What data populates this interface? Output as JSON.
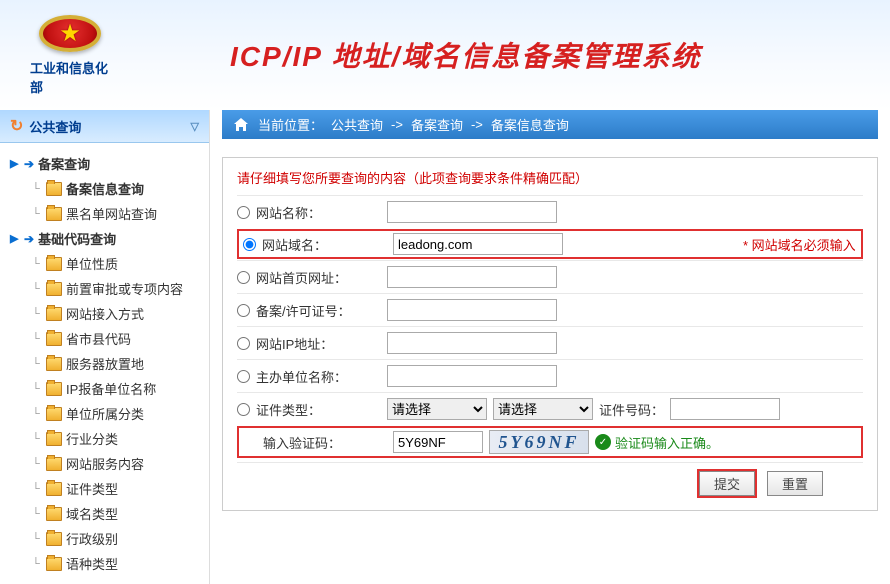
{
  "header": {
    "ministry": "工业和信息化部",
    "title": "ICP/IP 地址/域名信息备案管理系统"
  },
  "sidebar": {
    "heading": "公共查询",
    "groups": [
      {
        "label": "备案查询",
        "children": [
          {
            "label": "备案信息查询",
            "selected": true
          },
          {
            "label": "黑名单网站查询"
          }
        ]
      },
      {
        "label": "基础代码查询",
        "children": [
          {
            "label": "单位性质"
          },
          {
            "label": "前置审批或专项内容"
          },
          {
            "label": "网站接入方式"
          },
          {
            "label": "省市县代码"
          },
          {
            "label": "服务器放置地"
          },
          {
            "label": "IP报备单位名称"
          },
          {
            "label": "单位所属分类"
          },
          {
            "label": "行业分类"
          },
          {
            "label": "网站服务内容"
          },
          {
            "label": "证件类型"
          },
          {
            "label": "域名类型"
          },
          {
            "label": "行政级别"
          },
          {
            "label": "语种类型"
          }
        ]
      }
    ]
  },
  "breadcrumb": {
    "prefix": "当前位置：",
    "parts": [
      "公共查询",
      "备案查询",
      "备案信息查询"
    ],
    "sep": "->"
  },
  "form": {
    "hint": "请仔细填写您所要查询的内容（此项查询要求条件精确匹配）",
    "rows": {
      "site_name": {
        "label": "网站名称：",
        "value": ""
      },
      "domain": {
        "label": "网站域名：",
        "value": "leadong.com",
        "required_hint": "* 网站域名必须输入"
      },
      "homepage": {
        "label": "网站首页网址：",
        "value": ""
      },
      "license": {
        "label": "备案/许可证号：",
        "value": ""
      },
      "ip": {
        "label": "网站IP地址：",
        "value": ""
      },
      "sponsor": {
        "label": "主办单位名称：",
        "value": ""
      },
      "cert": {
        "label": "证件类型：",
        "select1": "请选择",
        "select2": "请选择",
        "cert_no_label": "证件号码：",
        "cert_no": ""
      },
      "captcha": {
        "label": "输入验证码：",
        "value": "5Y69NF",
        "image_text": "5Y69NF",
        "ok_text": "验证码输入正确。"
      }
    },
    "buttons": {
      "submit": "提交",
      "reset": "重置"
    }
  }
}
